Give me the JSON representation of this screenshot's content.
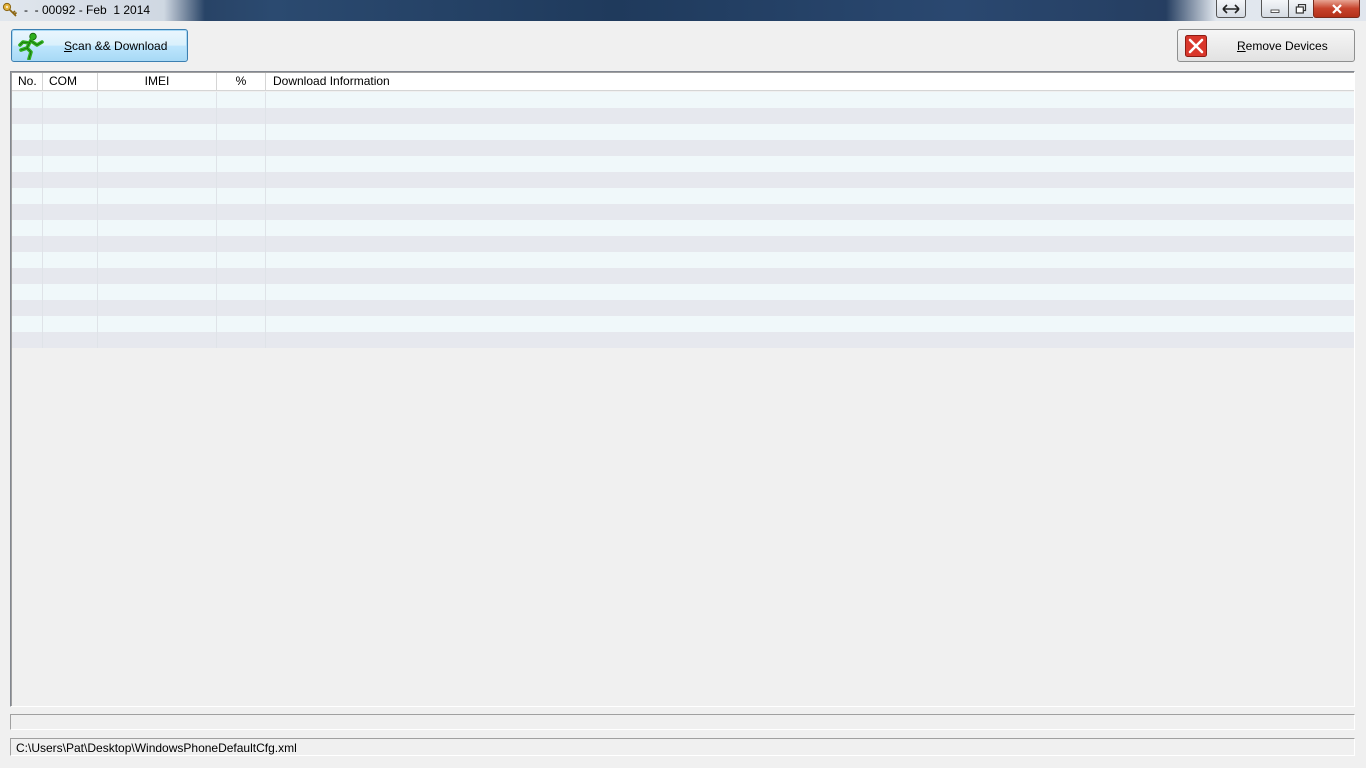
{
  "window": {
    "title": "-  - 00092 - Feb  1 2014"
  },
  "toolbar": {
    "scan_label_hotkey": "S",
    "scan_label_rest": "can && Download",
    "remove_label_hotkey": "R",
    "remove_label_rest": "emove Devices"
  },
  "device_list": {
    "columns": [
      "No.",
      "COM",
      "IMEI",
      "%",
      "Download Information"
    ],
    "rows": []
  },
  "status_bar": {
    "config_path": "C:\\Users\\Pat\\Desktop\\WindowsPhoneDefaultCfg.xml"
  },
  "colors": {
    "row_odd": "#f0f8fa",
    "row_even": "#e6e8ee",
    "close_button": "#c7432c",
    "scan_button_focus": "#3c7fb1"
  },
  "icons": {
    "app": "key-icon",
    "scan": "running-man-icon",
    "remove": "red-x-icon"
  }
}
